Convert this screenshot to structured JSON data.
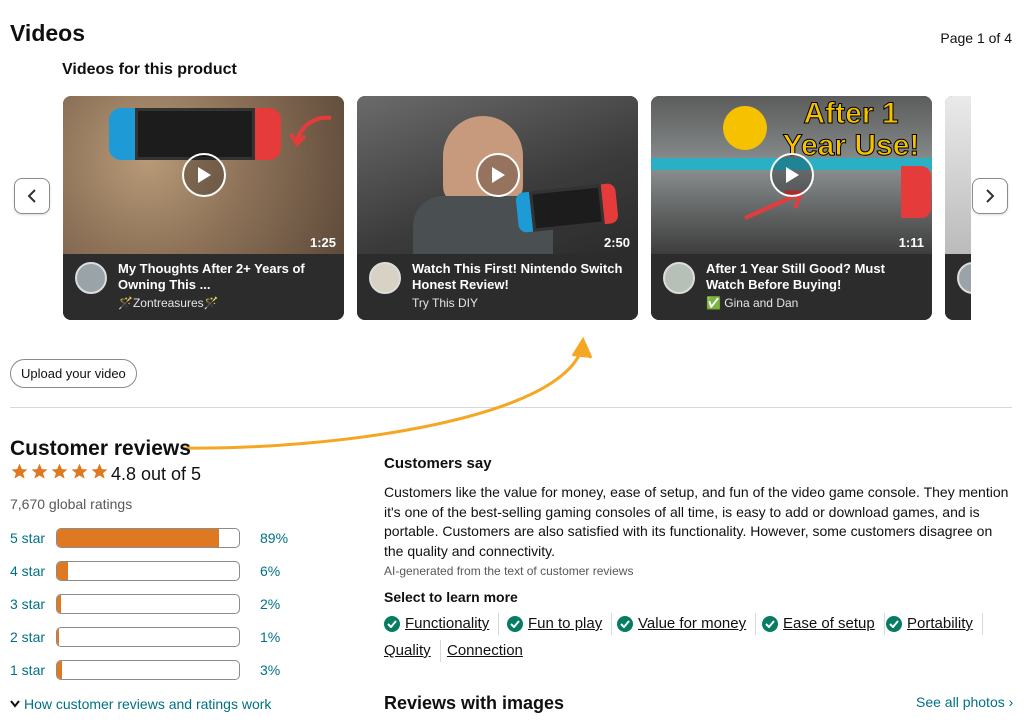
{
  "header": {
    "title": "Videos",
    "page_indicator": "Page 1 of 4",
    "subtitle": "Videos for this product"
  },
  "videos": [
    {
      "title": "My Thoughts After 2+ Years of Owning This ...",
      "author": "🪄Zontreasures🪄",
      "duration": "1:25"
    },
    {
      "title": "Watch This First! Nintendo Switch Honest Review!",
      "author": "Try This DIY",
      "duration": "2:50"
    },
    {
      "title": "After 1 Year Still Good? Must Watch Before Buying!",
      "author": "✅ Gina and Dan",
      "duration": "1:11",
      "overlay": "After 1 Year Use!"
    }
  ],
  "upload_label": "Upload your video",
  "reviews": {
    "title": "Customer reviews",
    "rating_text": "4.8 out of 5",
    "rating_value": 4.8,
    "global_ratings": "7,670 global ratings",
    "histogram": [
      {
        "label": "5 star",
        "pct": "89%",
        "value": 89
      },
      {
        "label": "4 star",
        "pct": "6%",
        "value": 6
      },
      {
        "label": "3 star",
        "pct": "2%",
        "value": 2
      },
      {
        "label": "2 star",
        "pct": "1%",
        "value": 1
      },
      {
        "label": "1 star",
        "pct": "3%",
        "value": 3
      }
    ],
    "how_link": "How customer reviews and ratings work"
  },
  "customers_say": {
    "title": "Customers say",
    "body": "Customers like the value for money, ease of setup, and fun of the video game console. They mention it's one of the best-selling gaming consoles of all time, is easy to add or download games, and is portable. Customers are also satisfied with its functionality. However, some customers disagree on the quality and connectivity.",
    "ai_note": "AI-generated from the text of customer reviews",
    "select_label": "Select to learn more",
    "aspects": [
      "Functionality",
      "Fun to play",
      "Value for money",
      "Ease of setup",
      "Portability",
      "Quality",
      "Connection"
    ]
  },
  "reviews_with_images": {
    "title": "Reviews with images",
    "see_all": "See all photos ›"
  },
  "colors": {
    "star": "#de7921",
    "link": "#007185",
    "check": "#067d62"
  }
}
